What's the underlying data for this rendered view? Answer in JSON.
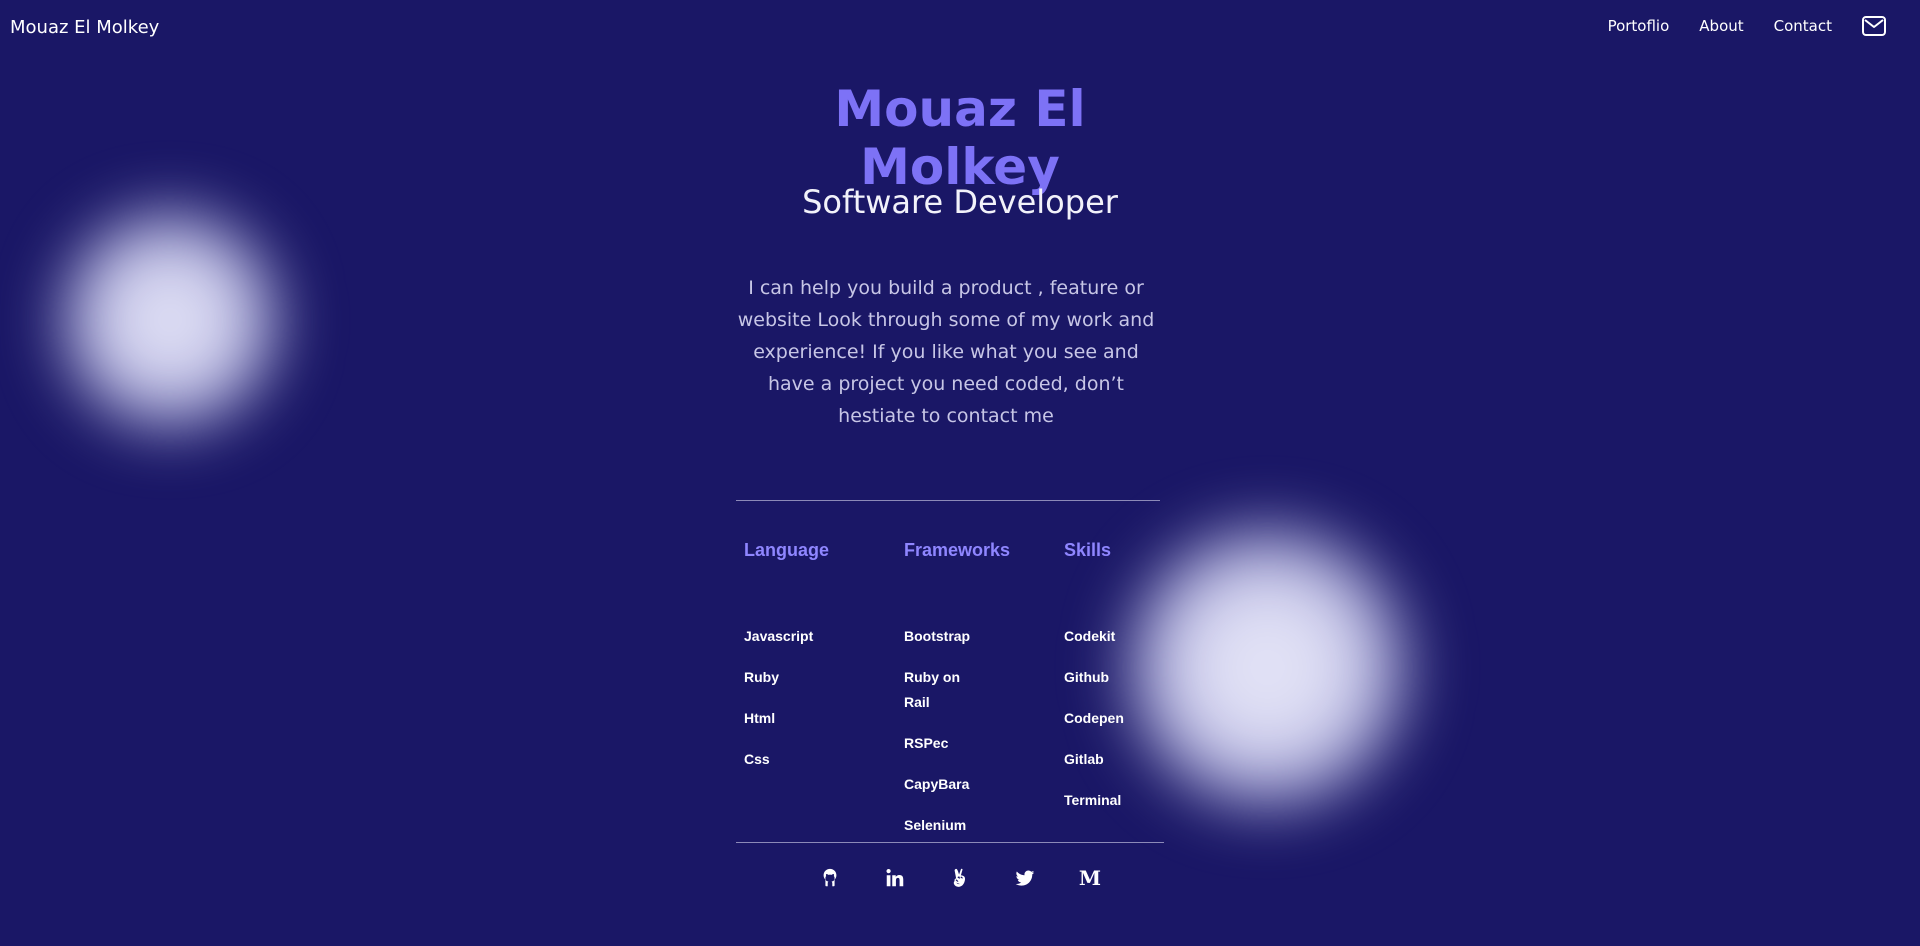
{
  "nav": {
    "brand": "Mouaz El Molkey",
    "links": [
      "Portoflio",
      "About",
      "Contact"
    ],
    "mail_icon": "mail-icon"
  },
  "hero": {
    "name": "Mouaz El Molkey",
    "role": "Software Developer",
    "description": "I can help you build a product , feature or website Look through some of my work and experience! If you like what you see and have a project you need coded, don’t hestiate to contact me"
  },
  "skills": {
    "columns": [
      {
        "title": "Language",
        "items": [
          "Javascript",
          "Ruby",
          "Html",
          "Css"
        ]
      },
      {
        "title": "Frameworks",
        "items": [
          "Bootstrap",
          "Ruby on Rail",
          "RSPec",
          "CapyBara",
          "Selenium"
        ]
      },
      {
        "title": "Skills",
        "items": [
          "Codekit",
          "Github",
          "Codepen",
          "Gitlab",
          "Terminal"
        ]
      }
    ]
  },
  "social": [
    "github-icon",
    "linkedin-icon",
    "angellist-icon",
    "twitter-icon",
    "medium-icon"
  ],
  "colors": {
    "background": "#1a1766",
    "accent": "#7d72f6",
    "column_title": "#8f86ff"
  }
}
